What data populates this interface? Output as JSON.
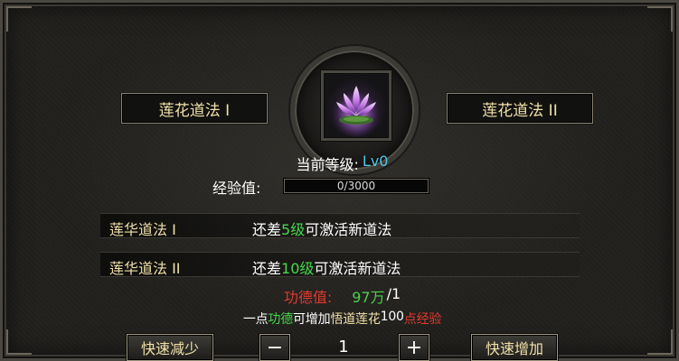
{
  "paths": {
    "left_label": "莲花道法 I",
    "right_label": "莲花道法 II"
  },
  "emblem": {
    "icon": "purple-lotus-icon"
  },
  "level": {
    "label": "当前等级:",
    "value": "Lv0"
  },
  "experience": {
    "label": "经验值:",
    "text": "0/3000",
    "progress": 0
  },
  "requirements": [
    {
      "name": "莲华道法 I",
      "prefix": "还差",
      "highlight": "5级",
      "suffix": "可激活新道法"
    },
    {
      "name": "莲华道法 II",
      "prefix": "还差",
      "highlight": "10级",
      "suffix": "可激活新道法"
    }
  ],
  "merit": {
    "label": "功德值:",
    "value": "97万",
    "slash": "/1"
  },
  "hint": {
    "p1": "一点",
    "p2": "功德",
    "p3": "可增加",
    "p4": "悟道莲花",
    "p5": "100",
    "p6": "点经验"
  },
  "controls": {
    "fast_decrease": "快速减少",
    "minus": "−",
    "quantity": "1",
    "plus": "+",
    "fast_increase": "快速增加"
  },
  "colors": {
    "gold_text": "#f0e0a8",
    "green_highlight": "#45d84a",
    "red_label": "#e23a2e",
    "level_cyan": "#4fc6e8"
  }
}
